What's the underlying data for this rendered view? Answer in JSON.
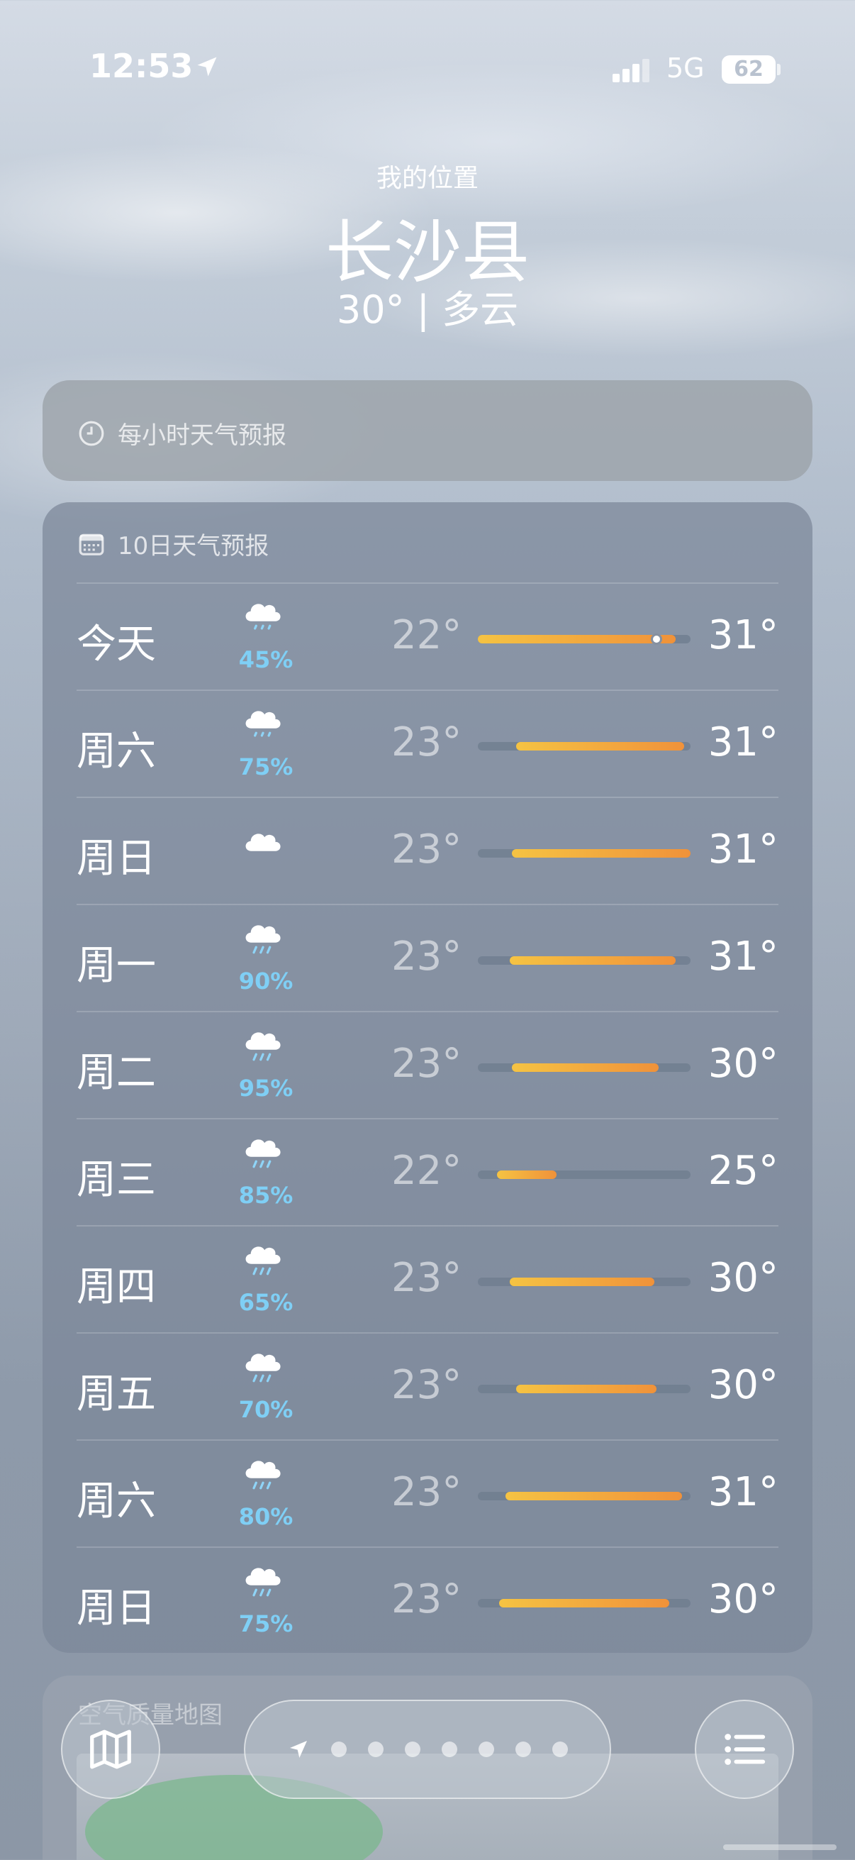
{
  "status_bar": {
    "time": "12:53",
    "network": "5G",
    "battery": "62"
  },
  "header": {
    "subtitle": "我的位置",
    "city": "长沙县",
    "summary": "30° | 多云"
  },
  "hourly_card": {
    "title": "每小时天气预报"
  },
  "daily_card": {
    "title": "10日天气预报",
    "days": [
      {
        "day": "今天",
        "icon": "rain-cloud-icon",
        "precip": "45%",
        "low": "22°",
        "high": "31°",
        "bar_start": 0.0,
        "bar_end": 0.93,
        "current": 0.84
      },
      {
        "day": "周六",
        "icon": "rain-cloud-icon",
        "precip": "75%",
        "low": "23°",
        "high": "31°",
        "bar_start": 0.18,
        "bar_end": 0.97
      },
      {
        "day": "周日",
        "icon": "cloud-icon",
        "precip": "",
        "low": "23°",
        "high": "31°",
        "bar_start": 0.16,
        "bar_end": 1.0
      },
      {
        "day": "周一",
        "icon": "heavy-rain-cloud-icon",
        "precip": "90%",
        "low": "23°",
        "high": "31°",
        "bar_start": 0.15,
        "bar_end": 0.93
      },
      {
        "day": "周二",
        "icon": "heavy-rain-cloud-icon",
        "precip": "95%",
        "low": "23°",
        "high": "30°",
        "bar_start": 0.16,
        "bar_end": 0.85
      },
      {
        "day": "周三",
        "icon": "heavy-rain-cloud-icon",
        "precip": "85%",
        "low": "22°",
        "high": "25°",
        "bar_start": 0.09,
        "bar_end": 0.37
      },
      {
        "day": "周四",
        "icon": "heavy-rain-cloud-icon",
        "precip": "65%",
        "low": "23°",
        "high": "30°",
        "bar_start": 0.15,
        "bar_end": 0.83
      },
      {
        "day": "周五",
        "icon": "heavy-rain-cloud-icon",
        "precip": "70%",
        "low": "23°",
        "high": "30°",
        "bar_start": 0.18,
        "bar_end": 0.84
      },
      {
        "day": "周六",
        "icon": "heavy-rain-cloud-icon",
        "precip": "80%",
        "low": "23°",
        "high": "31°",
        "bar_start": 0.13,
        "bar_end": 0.96
      },
      {
        "day": "周日",
        "icon": "heavy-rain-cloud-icon",
        "precip": "75%",
        "low": "23°",
        "high": "30°",
        "bar_start": 0.1,
        "bar_end": 0.9
      }
    ]
  },
  "lower_card": {
    "title": "空气质量地图"
  },
  "toolbar": {
    "page_count": 7
  },
  "colors": {
    "precip": "#7fcff5",
    "bar_start": "#f5c343",
    "bar_end": "#f0923a"
  }
}
